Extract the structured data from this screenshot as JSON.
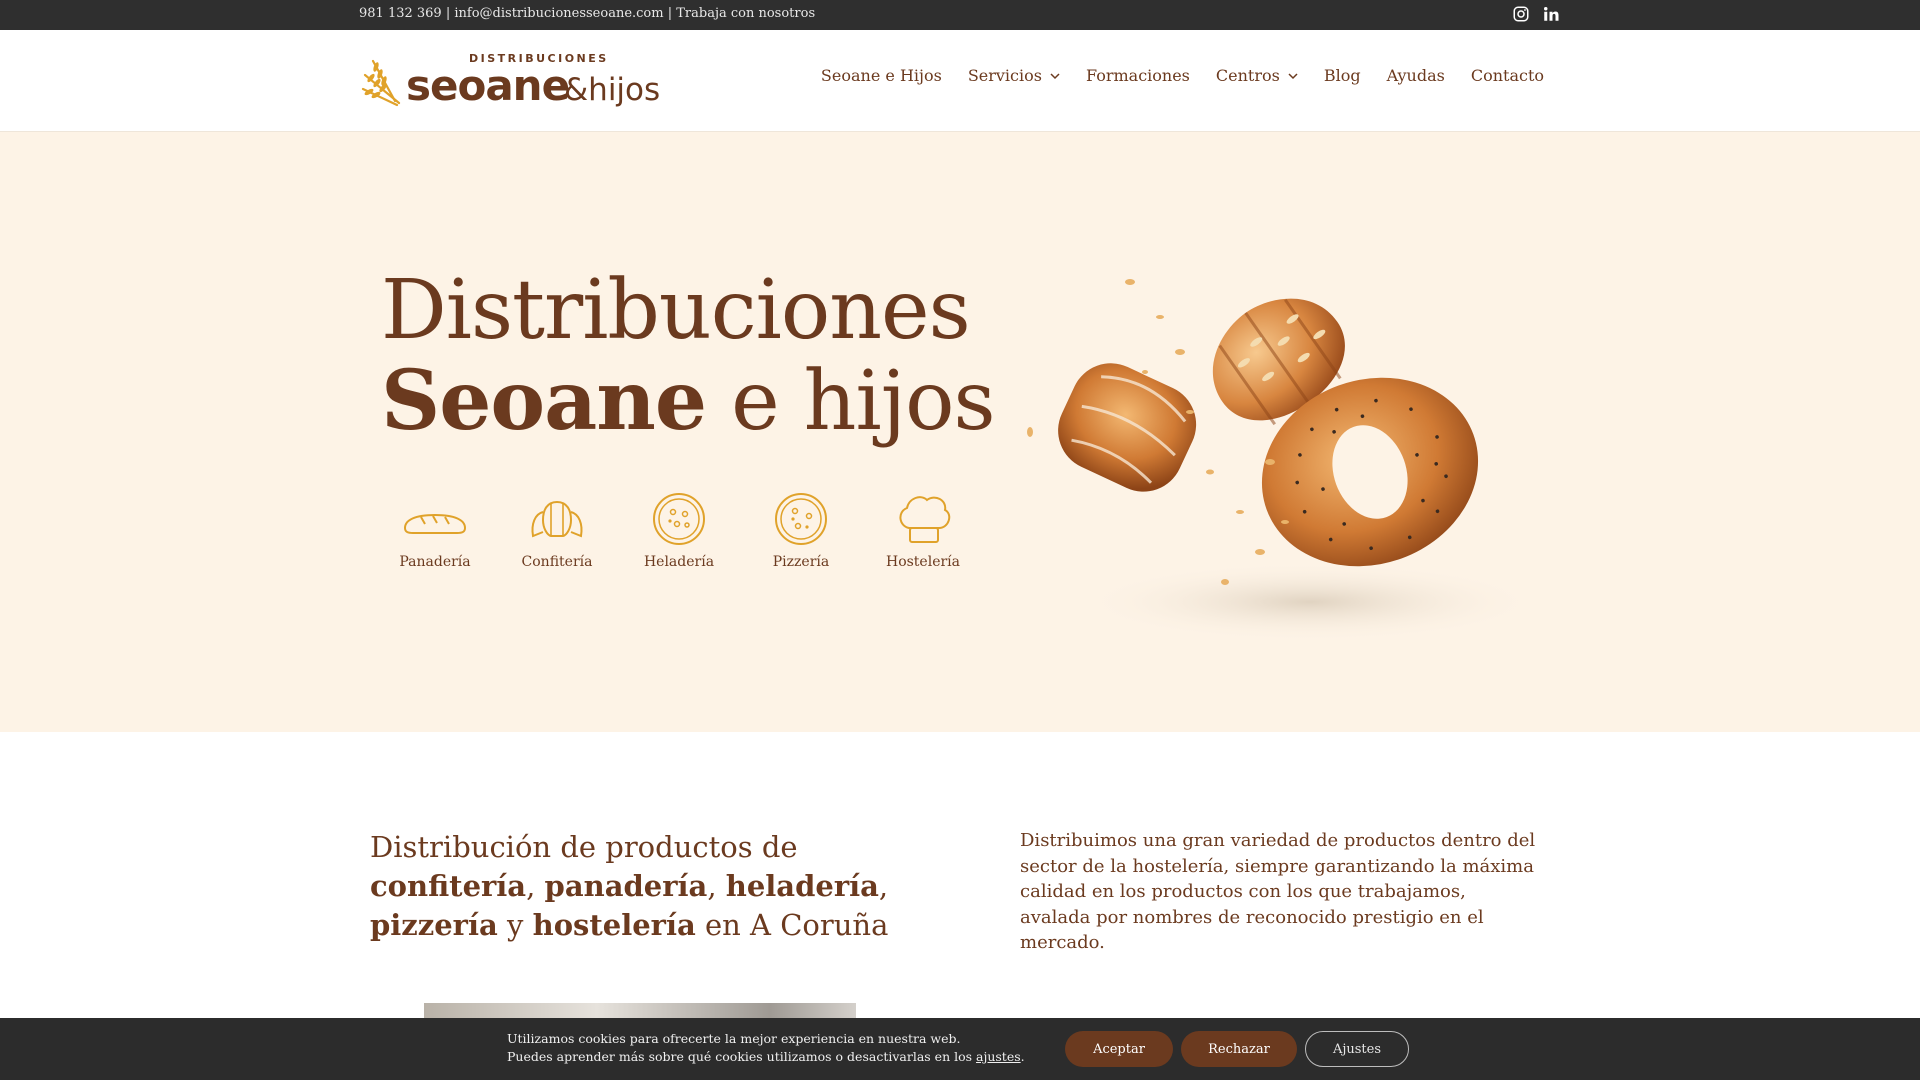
{
  "topbar": {
    "phone": "981 132 369",
    "email": "info@distribucionesseoane.com",
    "jobs": "Trabaja con nosotros",
    "separator": "|",
    "social": [
      "instagram-icon",
      "linkedin-icon"
    ]
  },
  "logo": {
    "top": "DISTRIBUCIONES",
    "main": "seoane",
    "sub": "&hijos"
  },
  "nav": [
    {
      "label": "Seoane e Hijos",
      "dropdown": false
    },
    {
      "label": "Servicios",
      "dropdown": true
    },
    {
      "label": "Formaciones",
      "dropdown": false
    },
    {
      "label": "Centros",
      "dropdown": true
    },
    {
      "label": "Blog",
      "dropdown": false
    },
    {
      "label": "Ayudas",
      "dropdown": false
    },
    {
      "label": "Contacto",
      "dropdown": false
    }
  ],
  "hero": {
    "line1": "Distribuciones",
    "line2_bold": "Seoane",
    "line2_rest": " e hijos",
    "categories": [
      {
        "label": "Panadería",
        "icon": "bread-icon"
      },
      {
        "label": "Confitería",
        "icon": "croissant-icon"
      },
      {
        "label": "Heladería",
        "icon": "ice-cream-icon"
      },
      {
        "label": "Pizzería",
        "icon": "pizza-icon"
      },
      {
        "label": "Hostelería",
        "icon": "chef-hat-icon"
      }
    ]
  },
  "intro": {
    "t1": "Distribución de productos de",
    "b1": "confitería",
    "s1": ", ",
    "b2": "panadería",
    "s2": ", ",
    "b3": "heladería",
    "s3": ",",
    "b4": "pizzería",
    "s4": " y ",
    "b5": "hostelería",
    "s5": " en A Coruña",
    "text": "Distribuimos una gran variedad de productos dentro del sector de la hostelería, siempre garantizando la máxima calidad en los productos con los que trabajamos, avalada por nombres de reconocido prestigio en el mercado."
  },
  "cookie": {
    "line1": "Utilizamos cookies para ofrecerte la mejor experiencia en nuestra web.",
    "line2": "Puedes aprender más sobre qué cookies utilizamos o desactivarlas en los ",
    "link": "ajustes",
    "end": ".",
    "accept": "Aceptar",
    "reject": "Rechazar",
    "settings": "Ajustes"
  },
  "colors": {
    "brand_brown": "#6b3a1f",
    "accent_gold": "#e0a22a",
    "hero_bg": "#fdf3e6",
    "topbar_bg": "#2f2f2f",
    "cookie_bg": "#2c2c2c"
  }
}
